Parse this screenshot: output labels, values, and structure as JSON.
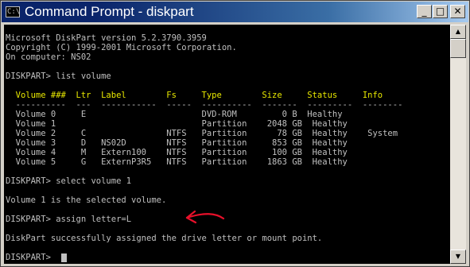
{
  "window": {
    "title": "Command Prompt - diskpart"
  },
  "controls": {
    "minimize": "_",
    "maximize": "□",
    "close": "✕"
  },
  "console": {
    "header": [
      "Microsoft DiskPart version 5.2.3790.3959",
      "Copyright (C) 1999-2001 Microsoft Corporation.",
      "On computer: NS02"
    ],
    "prompt1": "DISKPART> list volume",
    "table_header": "  Volume ###  Ltr  Label        Fs     Type        Size     Status     Info",
    "table_sep": "  ----------  ---  -----------  -----  ----------  -------  ---------  --------",
    "rows": [
      "  Volume 0     E                       DVD-ROM         0 B  Healthy",
      "  Volume 1                             Partition    2048 GB  Healthy",
      "  Volume 2     C                NTFS   Partition      78 GB  Healthy    System",
      "  Volume 3     D   NS02D        NTFS   Partition     853 GB  Healthy",
      "  Volume 4     M   Extern100    NTFS   Partition     100 GB  Healthy",
      "  Volume 5     G   ExternP3R5   NTFS   Partition    1863 GB  Healthy"
    ],
    "prompt2": "DISKPART> select volume 1",
    "msg1": "Volume 1 is the selected volume.",
    "prompt3": "DISKPART> assign letter=L",
    "msg2": "DiskPart successfully assigned the drive letter or mount point.",
    "prompt4": "DISKPART> "
  },
  "colors": {
    "text": "#c0c0c0",
    "highlight": "#e8e800",
    "annotation": "#e8102a"
  },
  "icons": {
    "title_icon": "console-app-icon",
    "annotation": "red-arrow-annotation"
  }
}
